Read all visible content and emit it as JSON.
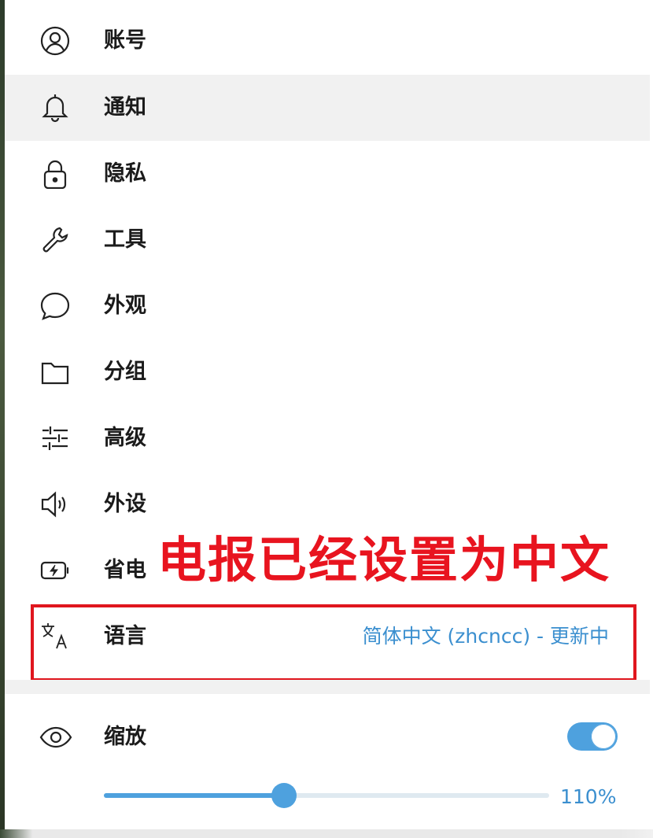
{
  "menu": {
    "items": [
      {
        "label": "账号",
        "icon": "account-icon"
      },
      {
        "label": "通知",
        "icon": "bell-icon",
        "active": true
      },
      {
        "label": "隐私",
        "icon": "lock-icon"
      },
      {
        "label": "工具",
        "icon": "wrench-icon"
      },
      {
        "label": "外观",
        "icon": "chat-bubble-icon"
      },
      {
        "label": "分组",
        "icon": "folder-icon"
      },
      {
        "label": "高级",
        "icon": "sliders-icon"
      },
      {
        "label": "外设",
        "icon": "speaker-icon"
      },
      {
        "label": "省电",
        "icon": "battery-icon"
      },
      {
        "label": "语言",
        "icon": "translate-icon",
        "value": "简体中文 (zhcncc) - 更新中"
      }
    ]
  },
  "annotation": {
    "text": "电报已经设置为中文",
    "color": "#e0161e"
  },
  "zoom": {
    "label": "缩放",
    "icon": "eye-icon",
    "toggle_on": true,
    "slider_fraction": 0.405,
    "value_label": "110%"
  },
  "colors": {
    "accent": "#4ea1de",
    "active_row": "#f1f1f1",
    "text": "#1b1b1b"
  }
}
